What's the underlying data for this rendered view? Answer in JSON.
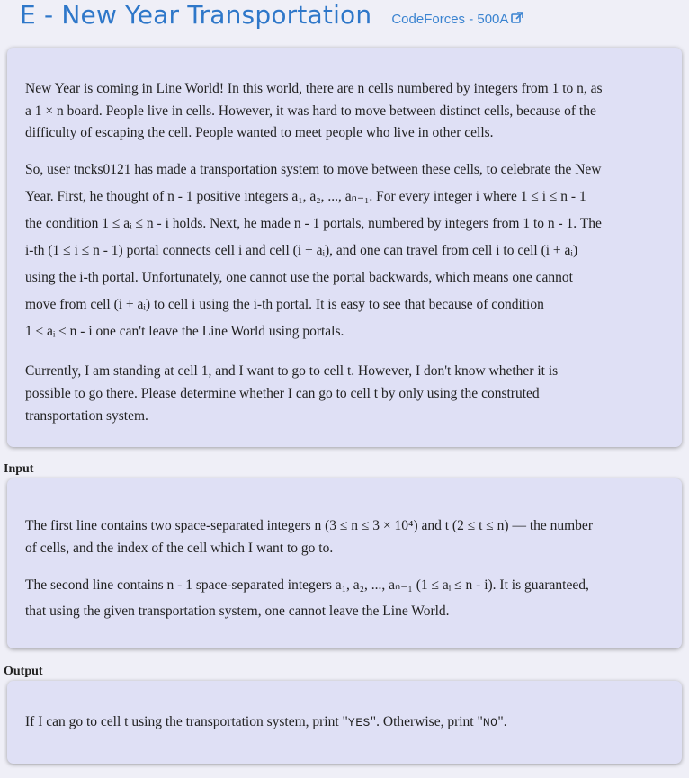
{
  "header": {
    "title": "E - New Year Transportation",
    "source_link": "CodeForces - 500A",
    "link_icon": "external-link-icon",
    "accent_color": "#2e77c9"
  },
  "statement": {
    "p1": [
      "New Year is coming in Line World! In this world, there are n cells numbered by integers from 1 to n, as",
      "a 1 × n board. People live in cells. However, it was hard to move between distinct cells, because of the",
      "difficulty of escaping the cell. People wanted to meet people who live in other cells."
    ],
    "p2": [
      "So, user tncks0121 has made a transportation system to move between these cells, to celebrate the New",
      "Year. First, he thought of n - 1 positive integers a₁, a₂, ..., aₙ₋₁. For every integer i where 1 ≤ i ≤ n - 1",
      "the condition 1 ≤ aᵢ ≤ n - i holds. Next, he made n - 1 portals, numbered by integers from 1 to n - 1. The",
      "i-th (1 ≤ i ≤ n - 1) portal connects cell i and cell (i + aᵢ), and one can travel from cell i to cell (i + aᵢ)",
      "using the i-th portal. Unfortunately, one cannot use the portal backwards, which means one cannot",
      "move from cell (i + aᵢ) to cell i using the i-th portal. It is easy to see that because of condition",
      "1 ≤ aᵢ ≤ n - i one can't leave the Line World using portals."
    ],
    "p3": [
      "Currently, I am standing at cell 1, and I want to go to cell t. However, I don't know whether it is",
      "possible to go there. Please determine whether I can go to cell t by only using the construted",
      "transportation system."
    ]
  },
  "input": {
    "label": "Input",
    "p1": [
      "The first line contains two space-separated integers n (3 ≤ n ≤ 3 × 10⁴) and t (2 ≤ t ≤ n) — the number",
      "of cells, and the index of the cell which I want to go to."
    ],
    "p2": [
      "The second line contains n - 1 space-separated integers a₁, a₂, ..., aₙ₋₁ (1 ≤ aᵢ ≤ n - i). It is guaranteed,",
      "that using the given transportation system, one cannot leave the Line World."
    ]
  },
  "output": {
    "label": "Output",
    "text_before": "If I can go to cell t using the transportation system, print \"",
    "yes": "YES",
    "text_middle": "\". Otherwise, print \"",
    "no": "NO",
    "text_after": "\"."
  }
}
